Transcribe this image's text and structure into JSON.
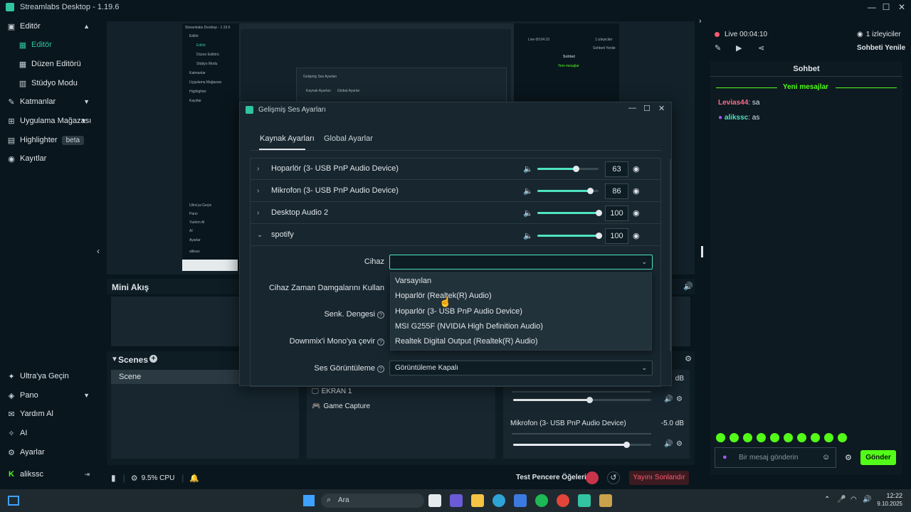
{
  "window": {
    "title": "Streamlabs Desktop - 1.19.6"
  },
  "sidebar": {
    "items": [
      {
        "label": "Editör"
      },
      {
        "label": "Editör"
      },
      {
        "label": "Düzen Editörü"
      },
      {
        "label": "Stüdyo Modu"
      },
      {
        "label": "Katmanlar"
      },
      {
        "label": "Uygulama Mağazası"
      },
      {
        "label": "Highlighter",
        "badge": "beta"
      },
      {
        "label": "Kayıtlar"
      }
    ],
    "bottom": [
      {
        "label": "Ultra'ya Geçin"
      },
      {
        "label": "Pano"
      },
      {
        "label": "Yardım Al"
      },
      {
        "label": "AI"
      },
      {
        "label": "Ayarlar"
      },
      {
        "label": "alikssc"
      }
    ]
  },
  "mini": {
    "title": "Mini Akış"
  },
  "scenes": {
    "title": "Scenes",
    "items": [
      "Scene"
    ],
    "sources": [
      "EKRAN 1",
      "Game Capture"
    ]
  },
  "mixer": {
    "top_db": "dB",
    "mic_name": "Mikrofon (3- USB PnP Audio Device)",
    "mic_db": "-5.0 dB",
    "level1": 0.55,
    "level2": 0.82
  },
  "status": {
    "cpu": "9.5% CPU",
    "test_label": "Test Pencere Öğeleri",
    "end_stream": "Yayını Sonlandır"
  },
  "right": {
    "live": "Live",
    "time": "00:04:10",
    "viewers": "1 izleyiciler",
    "refresh": "Sohbeti Yenile",
    "chat_title": "Sohbet",
    "new_messages": "Yeni mesajlar",
    "messages": [
      {
        "user": "Levias44",
        "text": ": sa",
        "color": "#ff6e8a"
      },
      {
        "user": "alikssc",
        "text": ": as",
        "color": "#4fe3c1"
      }
    ],
    "input_placeholder": "Bir mesaj gönderin",
    "send": "Gönder"
  },
  "dialog": {
    "title": "Gelişmiş Ses Ayarları",
    "tabs": [
      "Kaynak Ayarları",
      "Global Ayarlar"
    ],
    "sources": [
      {
        "name": "Hoparlör (3- USB PnP Audio Device)",
        "value": "63",
        "level": 0.63
      },
      {
        "name": "Mikrofon (3- USB PnP Audio Device)",
        "value": "86",
        "level": 0.86
      },
      {
        "name": "Desktop Audio 2",
        "value": "100",
        "level": 1.0
      },
      {
        "name": "spotify",
        "value": "100",
        "level": 1.0
      }
    ],
    "fields": {
      "device": "Cihaz",
      "timestamps": "Cihaz Zaman Damgalarını Kullan",
      "sync": "Senk. Dengesi",
      "downmix": "Downmix'i Mono'ya çevir",
      "monitoring": "Ses Görüntüleme",
      "monitoring_value": "Görüntüleme Kapalı"
    },
    "dropdown_options": [
      "Varsayılan",
      "Hoparlör (Realtek(R) Audio)",
      "Hoparlör (3- USB PnP Audio Device)",
      "MSI G255F (NVIDIA High Definition Audio)",
      "Realtek Digital Output (Realtek(R) Audio)"
    ]
  },
  "preview": {
    "title": "Streamlabs Desktop - 1.19.6",
    "dialog_title": "Gelişmiş Ses Ayarları",
    "tab1": "Kaynak Ayarları",
    "tab2": "Global Ayarlar",
    "live": "Live 00:04:10",
    "viewers": "1 izleyiciler",
    "chat": "Sohbet",
    "refresh": "Sohbeti Yenile",
    "new_messages": "Yeni mesajlar",
    "nav": [
      "Editör",
      "Editör",
      "Düzen Editörü",
      "Stüdyo Modu",
      "Katmanlar",
      "Uygulama Mağazası",
      "Highlighter",
      "Kayıtlar"
    ],
    "nav_bottom": [
      "Ultra'ya Geçin",
      "Pano",
      "Yardım Al",
      "AI",
      "Ayarlar",
      "alikssc"
    ]
  },
  "taskbar": {
    "search": "Ara",
    "time": "12:22",
    "date": "9.10.2025"
  }
}
